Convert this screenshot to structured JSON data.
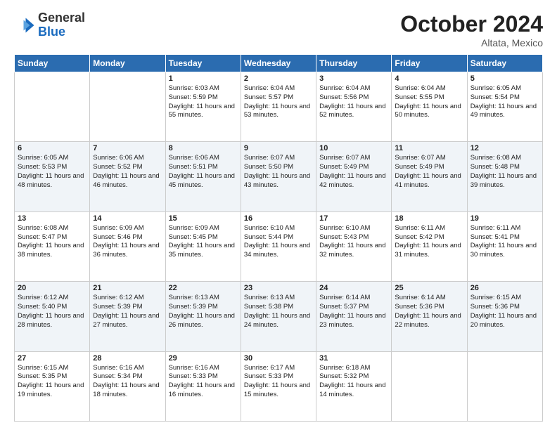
{
  "header": {
    "logo": {
      "general": "General",
      "blue": "Blue"
    },
    "title": "October 2024",
    "location": "Altata, Mexico"
  },
  "days_of_week": [
    "Sunday",
    "Monday",
    "Tuesday",
    "Wednesday",
    "Thursday",
    "Friday",
    "Saturday"
  ],
  "weeks": [
    [
      {
        "day": "",
        "content": ""
      },
      {
        "day": "",
        "content": ""
      },
      {
        "day": "1",
        "content": "Sunrise: 6:03 AM\nSunset: 5:59 PM\nDaylight: 11 hours and 55 minutes."
      },
      {
        "day": "2",
        "content": "Sunrise: 6:04 AM\nSunset: 5:57 PM\nDaylight: 11 hours and 53 minutes."
      },
      {
        "day": "3",
        "content": "Sunrise: 6:04 AM\nSunset: 5:56 PM\nDaylight: 11 hours and 52 minutes."
      },
      {
        "day": "4",
        "content": "Sunrise: 6:04 AM\nSunset: 5:55 PM\nDaylight: 11 hours and 50 minutes."
      },
      {
        "day": "5",
        "content": "Sunrise: 6:05 AM\nSunset: 5:54 PM\nDaylight: 11 hours and 49 minutes."
      }
    ],
    [
      {
        "day": "6",
        "content": "Sunrise: 6:05 AM\nSunset: 5:53 PM\nDaylight: 11 hours and 48 minutes."
      },
      {
        "day": "7",
        "content": "Sunrise: 6:06 AM\nSunset: 5:52 PM\nDaylight: 11 hours and 46 minutes."
      },
      {
        "day": "8",
        "content": "Sunrise: 6:06 AM\nSunset: 5:51 PM\nDaylight: 11 hours and 45 minutes."
      },
      {
        "day": "9",
        "content": "Sunrise: 6:07 AM\nSunset: 5:50 PM\nDaylight: 11 hours and 43 minutes."
      },
      {
        "day": "10",
        "content": "Sunrise: 6:07 AM\nSunset: 5:49 PM\nDaylight: 11 hours and 42 minutes."
      },
      {
        "day": "11",
        "content": "Sunrise: 6:07 AM\nSunset: 5:49 PM\nDaylight: 11 hours and 41 minutes."
      },
      {
        "day": "12",
        "content": "Sunrise: 6:08 AM\nSunset: 5:48 PM\nDaylight: 11 hours and 39 minutes."
      }
    ],
    [
      {
        "day": "13",
        "content": "Sunrise: 6:08 AM\nSunset: 5:47 PM\nDaylight: 11 hours and 38 minutes."
      },
      {
        "day": "14",
        "content": "Sunrise: 6:09 AM\nSunset: 5:46 PM\nDaylight: 11 hours and 36 minutes."
      },
      {
        "day": "15",
        "content": "Sunrise: 6:09 AM\nSunset: 5:45 PM\nDaylight: 11 hours and 35 minutes."
      },
      {
        "day": "16",
        "content": "Sunrise: 6:10 AM\nSunset: 5:44 PM\nDaylight: 11 hours and 34 minutes."
      },
      {
        "day": "17",
        "content": "Sunrise: 6:10 AM\nSunset: 5:43 PM\nDaylight: 11 hours and 32 minutes."
      },
      {
        "day": "18",
        "content": "Sunrise: 6:11 AM\nSunset: 5:42 PM\nDaylight: 11 hours and 31 minutes."
      },
      {
        "day": "19",
        "content": "Sunrise: 6:11 AM\nSunset: 5:41 PM\nDaylight: 11 hours and 30 minutes."
      }
    ],
    [
      {
        "day": "20",
        "content": "Sunrise: 6:12 AM\nSunset: 5:40 PM\nDaylight: 11 hours and 28 minutes."
      },
      {
        "day": "21",
        "content": "Sunrise: 6:12 AM\nSunset: 5:39 PM\nDaylight: 11 hours and 27 minutes."
      },
      {
        "day": "22",
        "content": "Sunrise: 6:13 AM\nSunset: 5:39 PM\nDaylight: 11 hours and 26 minutes."
      },
      {
        "day": "23",
        "content": "Sunrise: 6:13 AM\nSunset: 5:38 PM\nDaylight: 11 hours and 24 minutes."
      },
      {
        "day": "24",
        "content": "Sunrise: 6:14 AM\nSunset: 5:37 PM\nDaylight: 11 hours and 23 minutes."
      },
      {
        "day": "25",
        "content": "Sunrise: 6:14 AM\nSunset: 5:36 PM\nDaylight: 11 hours and 22 minutes."
      },
      {
        "day": "26",
        "content": "Sunrise: 6:15 AM\nSunset: 5:36 PM\nDaylight: 11 hours and 20 minutes."
      }
    ],
    [
      {
        "day": "27",
        "content": "Sunrise: 6:15 AM\nSunset: 5:35 PM\nDaylight: 11 hours and 19 minutes."
      },
      {
        "day": "28",
        "content": "Sunrise: 6:16 AM\nSunset: 5:34 PM\nDaylight: 11 hours and 18 minutes."
      },
      {
        "day": "29",
        "content": "Sunrise: 6:16 AM\nSunset: 5:33 PM\nDaylight: 11 hours and 16 minutes."
      },
      {
        "day": "30",
        "content": "Sunrise: 6:17 AM\nSunset: 5:33 PM\nDaylight: 11 hours and 15 minutes."
      },
      {
        "day": "31",
        "content": "Sunrise: 6:18 AM\nSunset: 5:32 PM\nDaylight: 11 hours and 14 minutes."
      },
      {
        "day": "",
        "content": ""
      },
      {
        "day": "",
        "content": ""
      }
    ]
  ]
}
